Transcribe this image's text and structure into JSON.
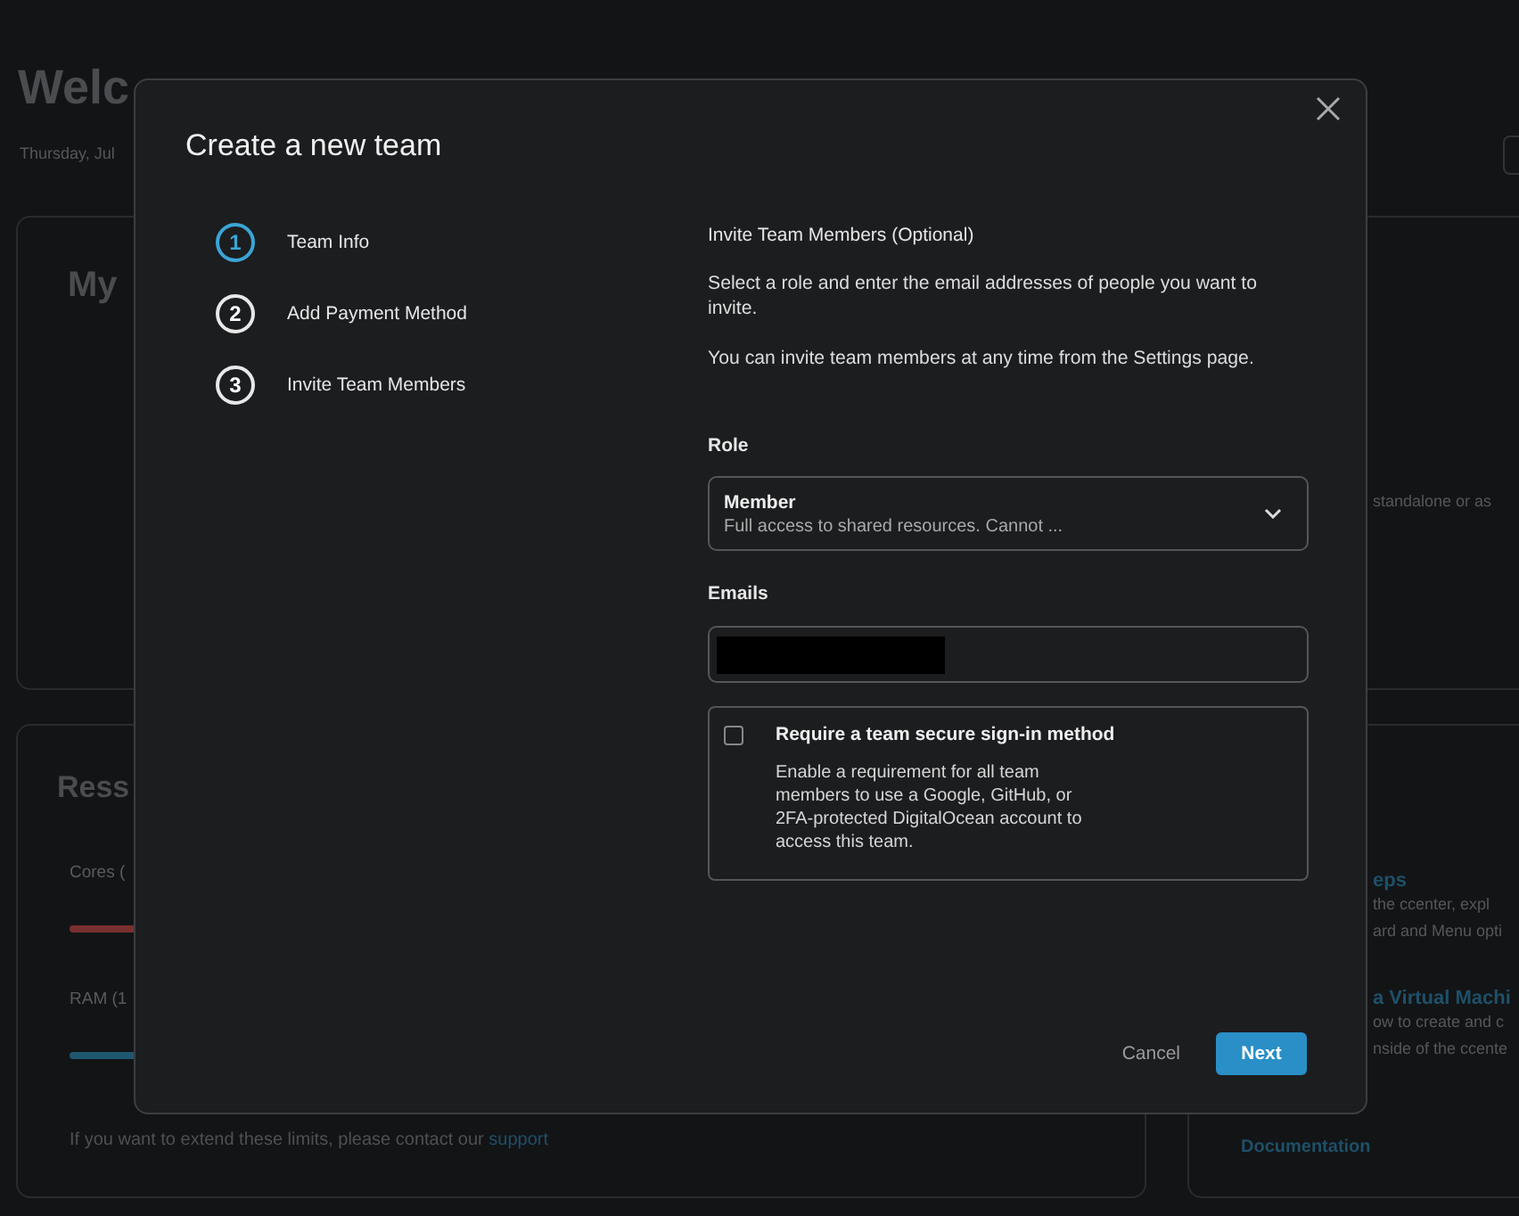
{
  "page": {
    "heading": "Welc",
    "date": "Thursday, Jul"
  },
  "projects_card": {
    "title": "My",
    "fragment": "standalone or as"
  },
  "resources_card": {
    "title": "Ress",
    "meters": [
      {
        "label": "Cores (",
        "color": "#7a2f2f"
      },
      {
        "label": "RAM (1",
        "color": "#1f5670"
      }
    ],
    "note": "If you want to extend these limits, please contact our",
    "note_link": "support"
  },
  "docs_card": {
    "items": [
      {
        "title": "eps",
        "lines": [
          "the ccenter, expl",
          "ard and Menu opti"
        ]
      },
      {
        "title": "a Virtual Machi",
        "lines": [
          "ow to create and c",
          "nside of the ccente"
        ]
      }
    ],
    "link": "Documentation"
  },
  "modal": {
    "title": "Create a new team",
    "steps": [
      {
        "number": "1",
        "label": "Team Info",
        "selected": true
      },
      {
        "number": "2",
        "label": "Add Payment Method",
        "selected": false
      },
      {
        "number": "3",
        "label": "Invite Team Members",
        "selected": false
      }
    ],
    "section_title": "Invite Team Members (Optional)",
    "paragraphs": [
      "Select a role and enter the email addresses of people you want to invite.",
      "You can invite team members at any time from the Settings page."
    ],
    "role_label": "Role",
    "role": {
      "value": "Member",
      "description": "Full access to shared resources. Cannot ..."
    },
    "emails_label": "Emails",
    "secure_signin": {
      "checked": false,
      "label": "Require a team secure sign-in method",
      "description": "Enable a requirement for all team members to use a Google, GitHub, or 2FA-protected DigitalOcean account to access this team."
    },
    "buttons": {
      "cancel": "Cancel",
      "next": "Next"
    }
  }
}
